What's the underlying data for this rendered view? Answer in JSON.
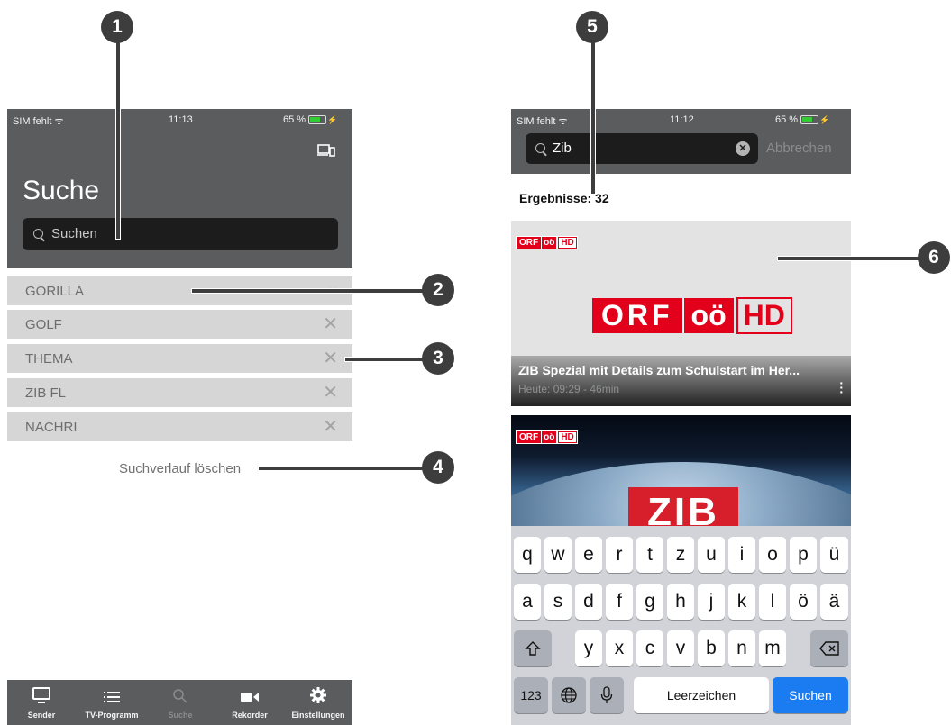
{
  "left": {
    "status": {
      "carrier": "SIM fehlt",
      "time": "11:13",
      "battery": "65 %"
    },
    "title": "Suche",
    "search_placeholder": "Suchen",
    "history": [
      "GORILLA",
      "GOLF",
      "THEMA",
      "ZIB FL",
      "NACHRI"
    ],
    "delete_glyph": "✕",
    "clear_history": "Suchverlauf löschen",
    "tabs": [
      "Sender",
      "TV-Programm",
      "Suche",
      "Rekorder",
      "Einstellungen"
    ]
  },
  "right": {
    "status": {
      "carrier": "SIM fehlt",
      "time": "11:12",
      "battery": "65 %"
    },
    "search_value": "Zib",
    "cancel": "Abbrechen",
    "results": "Ergebnisse: 32",
    "card1": {
      "title": "ZIB Spezial mit Details zum Schulstart im Her...",
      "subtitle": "Heute: 09:29 - 46min"
    },
    "logo": {
      "orf": "ORF",
      "oo": "oö",
      "hd": "HD"
    },
    "card2_text": "ZIB",
    "keyboard": {
      "row1": [
        "q",
        "w",
        "e",
        "r",
        "t",
        "z",
        "u",
        "i",
        "o",
        "p",
        "ü"
      ],
      "row2": [
        "a",
        "s",
        "d",
        "f",
        "g",
        "h",
        "j",
        "k",
        "l",
        "ö",
        "ä"
      ],
      "row3": [
        "y",
        "x",
        "c",
        "v",
        "b",
        "n",
        "m"
      ],
      "numbers": "123",
      "space": "Leerzeichen",
      "action": "Suchen"
    }
  },
  "callouts": [
    "1",
    "2",
    "3",
    "4",
    "5",
    "6"
  ],
  "colors": {
    "header": "#5a5c5d",
    "orf_red": "#e2001a",
    "ios_blue": "#1b7cf2",
    "callout": "#3d3d3d"
  }
}
